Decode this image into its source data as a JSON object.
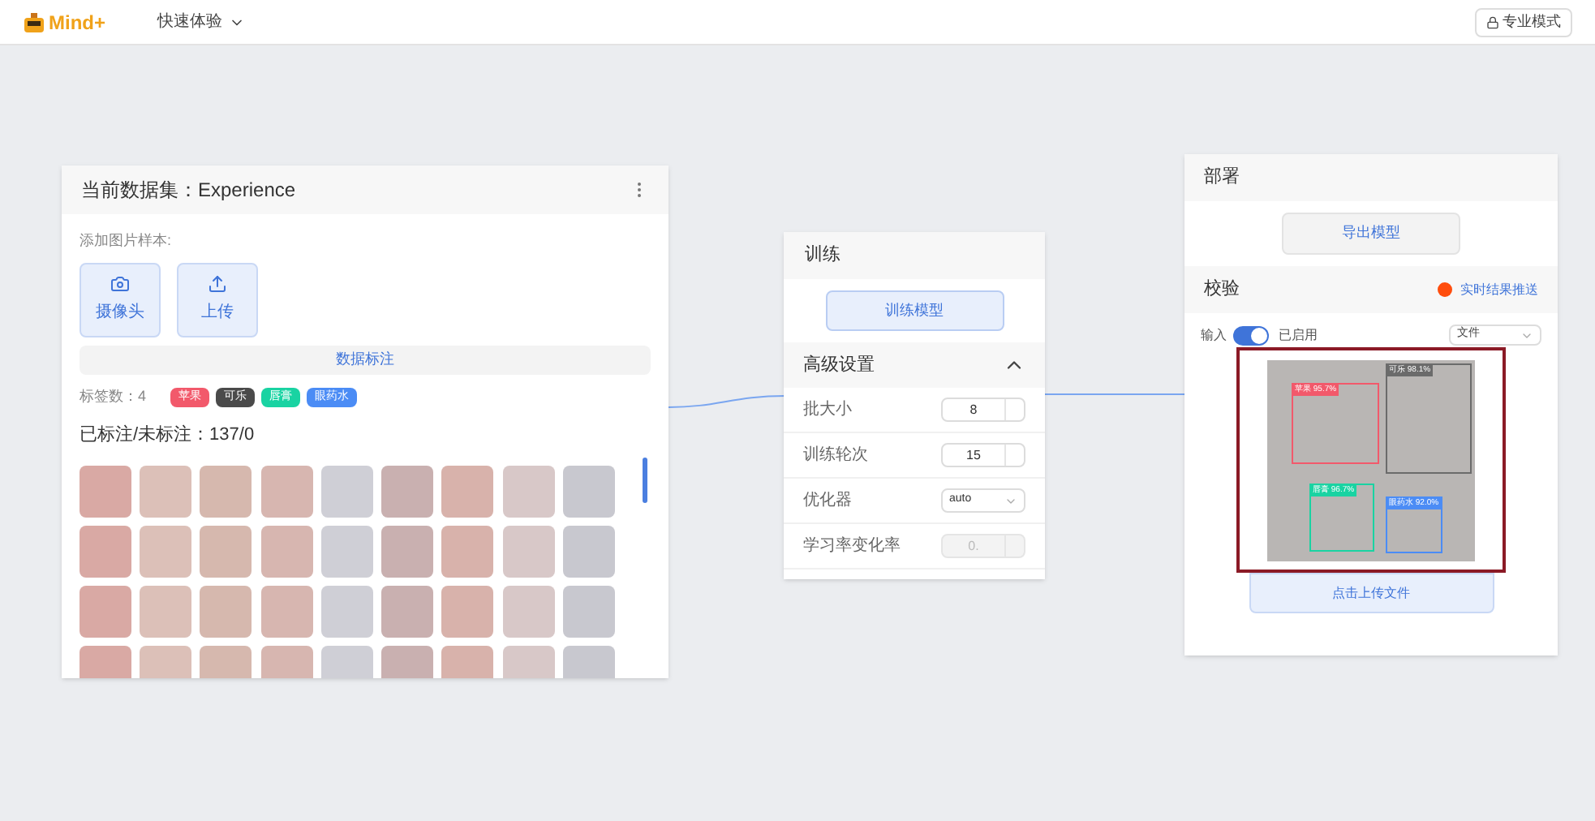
{
  "top_bar": {
    "logo": "Mind+",
    "mode_menu": "快速体验",
    "pro_button": "专业模式"
  },
  "dataset_card": {
    "title": "当前数据集：Experience",
    "add_label": "添加图片样本:",
    "sources": [
      {
        "kind": "camera",
        "label": "摄像头"
      },
      {
        "kind": "upload",
        "label": "上传"
      }
    ],
    "annotate_button": "数据标注",
    "tag_count": "标签数：4",
    "tags": [
      {
        "label": "苹果",
        "color": "#f2596b"
      },
      {
        "label": "可乐",
        "color": "#4a4a4a"
      },
      {
        "label": "唇膏",
        "color": "#19d3a2"
      },
      {
        "label": "眼药水",
        "color": "#4b8cf5"
      }
    ],
    "annotated": "已标注/未标注：137/0"
  },
  "train_card": {
    "title": "训练",
    "train_button": "训练模型",
    "advanced_title": "高级设置",
    "expanded": true,
    "settings": [
      {
        "kind": "number",
        "label": "批大小",
        "value": "8",
        "disabled": false
      },
      {
        "kind": "number",
        "label": "训练轮次",
        "value": "15",
        "disabled": false
      },
      {
        "kind": "select",
        "label": "优化器",
        "value": "auto",
        "disabled": false
      },
      {
        "kind": "number",
        "label": "学习率变化率",
        "value": "0.",
        "disabled": true
      }
    ]
  },
  "deploy_card": {
    "title": "部署",
    "export_button": "导出模型",
    "verify_title": "校验",
    "push_link": "实时结果推送",
    "input_label": "输入",
    "input_on": true,
    "input_state": "已启用",
    "source_select": "文件",
    "detections": [
      {
        "label": "苹果 95.7%",
        "color": "#f2596b"
      },
      {
        "label": "可乐 98.1%",
        "color": "#6b6b6b"
      },
      {
        "label": "唇膏 96.7%",
        "color": "#19d3a2"
      },
      {
        "label": "眼药水 92.0%",
        "color": "#4b8cf5"
      }
    ],
    "upload_button": "点击上传文件"
  }
}
